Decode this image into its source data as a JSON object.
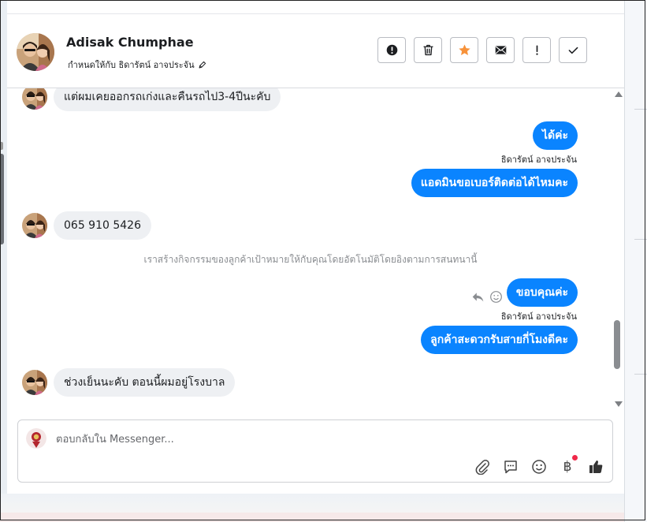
{
  "contact": {
    "name": "Adisak Chumphae",
    "assigned_to": "กำหนดให้กับ ธิดารัตน์ อาจประจัน"
  },
  "actions": [
    {
      "name": "mark-spam-button",
      "icon": "alert-circle-icon"
    },
    {
      "name": "delete-button",
      "icon": "trash-icon"
    },
    {
      "name": "star-button",
      "icon": "star-icon",
      "color": "#f7923a"
    },
    {
      "name": "mark-unread-button",
      "icon": "envelope-icon"
    },
    {
      "name": "follow-up-button",
      "icon": "exclamation-icon"
    },
    {
      "name": "mark-done-button",
      "icon": "checkmark-icon"
    }
  ],
  "messages": [
    {
      "direction": "in",
      "text": "แต่ผมเคยออกรถเก่งและคืนรถไป3-4ปีนะคับ"
    },
    {
      "direction": "out",
      "text": "ได้ค่ะ"
    },
    {
      "direction": "out",
      "sender": "ธิดารัตน์ อาจประจัน",
      "text": "แอดมินขอเบอร์ติดต่อได้ไหมคะ"
    },
    {
      "direction": "in",
      "text": "065 910 5426"
    },
    {
      "direction": "system",
      "text": "เราสร้างกิจกรรมของลูกค้าเป้าหมายให้กับคุณโดยอัตโนมัติโดยอิงตามการสนทนานี้"
    },
    {
      "direction": "out",
      "text": "ขอบคุณค่ะ"
    },
    {
      "direction": "out",
      "sender": "ธิดารัตน์ อาจประจัน",
      "text": "ลูกค้าสะดวกรับสายกี่โมงดีคะ"
    },
    {
      "direction": "in",
      "text": "ช่วงเย็นนะคับ ตอนนี้ผมอยู่โรงบาล"
    }
  ],
  "composer": {
    "placeholder": "ตอบกลับใน Messenger...",
    "value": "",
    "tools": [
      "paperclip-icon",
      "saved-reply-icon",
      "emoji-icon",
      "baht-payment-icon",
      "thumbs-up-icon"
    ]
  },
  "colors": {
    "outgoing_bubble": "#0a84ff",
    "incoming_bubble": "#eef0f3",
    "star": "#f7923a",
    "notification_dot": "#f02849"
  }
}
